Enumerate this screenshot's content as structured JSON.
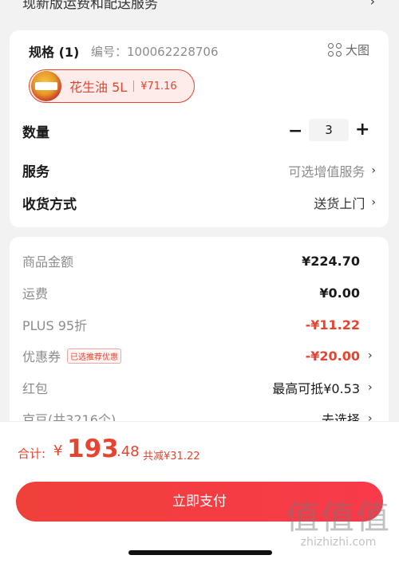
{
  "top_strip": {
    "partial_text": "现新版运费和配送服务"
  },
  "spec": {
    "header": "规格 (1)",
    "code": "编号：100062228706",
    "big_image_label": "大图",
    "selected": {
      "name": "花生油 5L",
      "price": "¥71.16"
    }
  },
  "quantity": {
    "label": "数量",
    "value": "3",
    "minus": "−",
    "plus": "+"
  },
  "service": {
    "label": "服务",
    "value": "可选增值服务"
  },
  "delivery": {
    "label": "收货方式",
    "value": "送货上门"
  },
  "price_rows": [
    {
      "label": "商品金额",
      "value": "¥224.70",
      "red": false,
      "chevron": false
    },
    {
      "label": "运费",
      "value": "¥0.00",
      "red": false,
      "chevron": false
    },
    {
      "label": "PLUS 95折",
      "value": "-¥11.22",
      "red": true,
      "chevron": false
    },
    {
      "label": "优惠券",
      "tag": "已选推荐优惠",
      "value": "-¥20.00",
      "red": true,
      "chevron": true
    },
    {
      "label": "红包",
      "value": "最高可抵¥0.53",
      "red": false,
      "chevron": true
    },
    {
      "label": "京豆(共3216个)",
      "value": "去选择",
      "red": false,
      "chevron": true
    }
  ],
  "footer": {
    "total_label": "合计:",
    "currency": "¥",
    "total_int": "193",
    "total_dec": ".48",
    "saved": "共减¥31.22",
    "pay_button": "立即支付"
  },
  "watermark": {
    "glyphs": "值值值",
    "url": "zhizhizhi.com"
  },
  "colors": {
    "accent": "#e8432f",
    "button": "#f0403a"
  }
}
